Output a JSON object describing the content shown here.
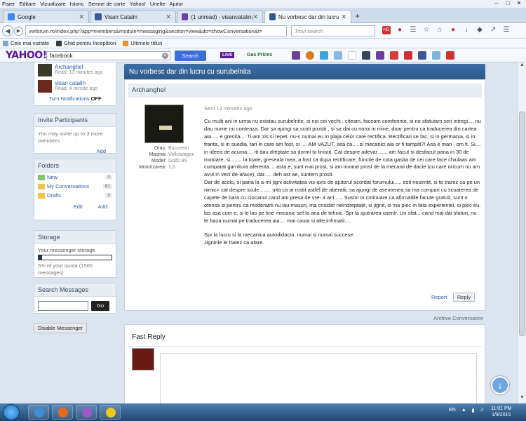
{
  "menu": [
    "Fișier",
    "Editare",
    "Vizualizare",
    "Istoric",
    "Semne de carte",
    "Yahoo!",
    "Unelte",
    "Ajutor"
  ],
  "tabs": [
    {
      "label": "Google",
      "color": "#4285f4"
    },
    {
      "label": "Visan Catalin",
      "color": "#3b5998"
    },
    {
      "label": "(1 unread) - visancatalin@...",
      "color": "#6b3fa0"
    },
    {
      "label": "Nu vorbesc dar din lucru c...",
      "color": "#2d5a8c"
    }
  ],
  "nav": {
    "url": "vwforum.ro/index.php?app=members&module=messaging&section=view&do=showConversation&t=",
    "search_placeholder": "Trovi search"
  },
  "bookmarks": [
    "Cele mai vizitate",
    "Ghid pentru începători",
    "Ultimele titluri"
  ],
  "yahoo": {
    "logo": "YAHOO!",
    "query": "facebook",
    "search_btn": "Search",
    "live": "LIVE",
    "gas": "Gas Prices"
  },
  "sidebar": {
    "participants": [
      {
        "name": "Archanghel",
        "time": "Read: 13 minutes ago"
      },
      {
        "name": "visan catalin",
        "time": "Read: A minute ago"
      }
    ],
    "turn_notifications": "Turn Notifications",
    "turn_state": "OFF",
    "invite": {
      "title": "Invite Participants",
      "text": "You may invite up to 3 more members",
      "add": "Add"
    },
    "folders": {
      "title": "Folders",
      "items": [
        {
          "name": "New",
          "count": "0"
        },
        {
          "name": "My Conversations",
          "count": "81"
        },
        {
          "name": "Drafts",
          "count": "0"
        }
      ],
      "edit": "Edit",
      "add": "Add"
    },
    "storage": {
      "title": "Storage",
      "label": "Your messenger storage",
      "quota": "5% of your quota (1500 messages)",
      "percent": 5
    },
    "search": {
      "title": "Search Messages",
      "go": "Go"
    },
    "disable": "Disable Messenger"
  },
  "conversation": {
    "title": "Nu vorbesc dar din lucru cu surubelnita",
    "author": "Archanghel",
    "sent": "Sent 13 minutes ago",
    "meta": [
      {
        "k": "Oraș:",
        "v": "Bucuresti"
      },
      {
        "k": "Mașina:",
        "v": "Volkswagen"
      },
      {
        "k": "Model:",
        "v": "Golf2.89"
      },
      {
        "k": "Motorizarea:",
        "v": "1,6"
      }
    ],
    "body": [
      "Cu multi ani in urma nu existau surubelnite, si noi cei vechi , citeam, faceam comferinte, si ne sfatuiam seri intregi.... nu dau nume nu conteaza. Dar sa ajungi sa scoti prostii , si sa dai cu noroi in mine, doar pentru ca traducerea din cartea aia..... e gresita.... Ti-am zis si repet, nu-s numai eu in plaja celor care rectifica. Rectificari se fac, si in germania, si in franta, si in suedia, tari in care am fost, si .... AM VAZUT, asa ca.... si mecanici aia or fi tampiti?! Asa e man , om fi. Si.... in ideea de acuma.... iti dau dreptate sa dormi tu linistit. Cat despre adevar....... am facut si desfacut pana in 30 de motoare, si........ la toate, greseala mea, a fost ca dupa rectificare, functie de cota gasita de cei care face chiulaas am cumparat garnitura aferenta.... asta e, sunt mai prost, si am invatat prost de la mecanii de dacie (cu care oricum nu am avut in veci de-aface), dar..... deh ast ae, suntem prosti.",
      "Dar de acolo, si pana la a-mi jigni activitatea vis-avis de ajutorul acordat forumului..... esti nesimtit, si te trarez ca pe un nimic> cat despre scule........ uita ca ai rostit astfel de aberatii, sa ajungi de asemenea sa ma compari cu scoaterea de capete de bara cu ciocanul cand am presa de vre- 4 ani...... Sustin in cntinuare ca afirmatiile facute gratuit, sunt o ofensa si pentru ca moderatrii nu iau masuri, ma cnsider neindreptatit, si jignit, si ma piec in fata experientei, si plec eu. las asa cum e, si le las pe tine mecanic sef la aria de tehnic. Spr la ajutrarea userilr. Un sfat... cand mai dai sfaturi, nu te baza numai pe traducerea aia.... mai cauta si alte infrmatii....",
      "Spr la lucru si la mecanica autodidacta. numai si numai succese.",
      "Jignirile le tratez ca atare."
    ],
    "report": "Report",
    "reply": "Reply",
    "archive": "Archive Conversation",
    "fast_reply": "Fast Reply"
  },
  "taskbar": {
    "lang": "EN",
    "time": "11:01 PM",
    "date": "1/9/2015"
  }
}
